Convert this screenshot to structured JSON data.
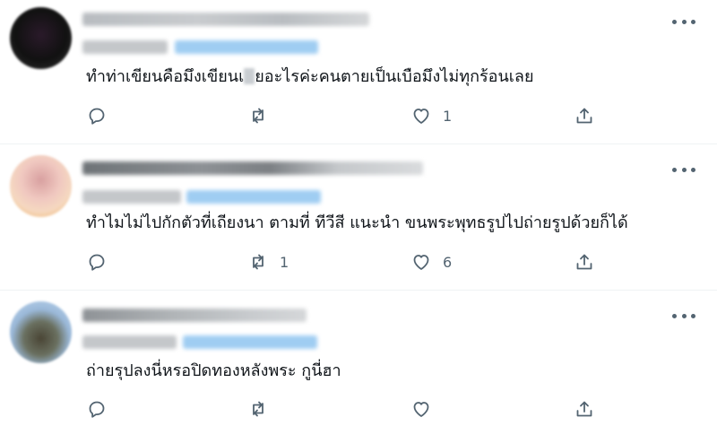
{
  "tweets": [
    {
      "text_before": "ทำท่าเขียนคือมึงเขียนเ",
      "text_after": "ยอะไรค่ะคนตายเป็นเบือมึงไม่ทุกร้อนเลย",
      "reply_count": "",
      "retweet_count": "",
      "like_count": "1"
    },
    {
      "text": "ทำไมไม่ไปกักตัวที่เถียงนา ตามที่ ทีวีสี แนะนำ ขนพระพุทธรูปไปถ่ายรูปด้วยก็ได้",
      "reply_count": "",
      "retweet_count": "1",
      "like_count": "6"
    },
    {
      "text": "ถ่ายรุปลงนี่หรอปิดทองหลังพระ กูนี่ฮา",
      "reply_count": "",
      "retweet_count": "",
      "like_count": ""
    }
  ],
  "icons": {
    "reply": "reply-icon",
    "retweet": "retweet-icon",
    "like": "heart-icon",
    "share": "share-icon",
    "more": "more-icon"
  },
  "colors": {
    "text": "#0f1419",
    "muted": "#536471",
    "link_blur": "#8ec5f0",
    "divider": "#eff3f4"
  }
}
